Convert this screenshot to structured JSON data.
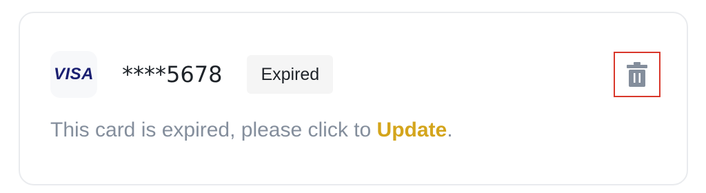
{
  "card": {
    "brand": "VISA",
    "masked_number": "****5678",
    "status": "Expired"
  },
  "icons": {
    "delete": "trash-icon"
  },
  "message": {
    "prefix": "This card is expired, please click to ",
    "link_label": "Update",
    "suffix": "."
  },
  "colors": {
    "brand": "#1a1f71",
    "link": "#d4a51c",
    "muted_text": "#848e9c",
    "badge_bg": "#f5f5f5",
    "highlight_border": "#d9372b",
    "icon": "#848e9c"
  }
}
